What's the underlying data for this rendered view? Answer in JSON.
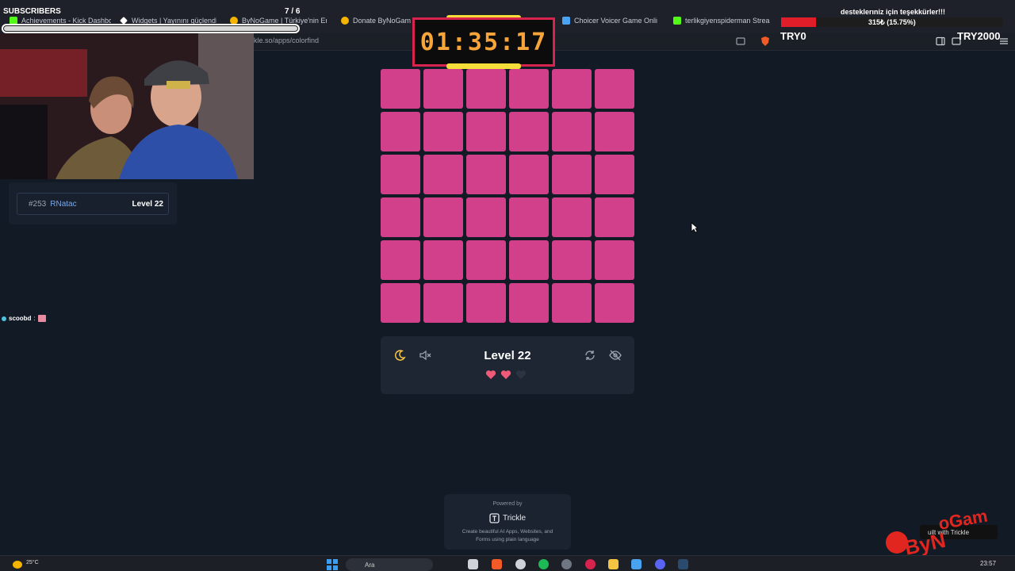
{
  "browser": {
    "tabs": [
      {
        "label": "Achievements - Kick Dashboa",
        "icon": "kick-icon",
        "color": "#53fc18"
      },
      {
        "label": "Widgets | Yayınını güçlendirm",
        "icon": "diamond-icon",
        "color": "#ffffff"
      },
      {
        "label": "ByNoGame | Türkiye'nin En B",
        "icon": "bynogame-icon",
        "color": "#f5b400"
      },
      {
        "label": "Donate ByNoGame |",
        "icon": "bynogame-icon",
        "color": "#f5b400"
      },
      {
        "label": "Choicer Voicer Game Online F",
        "icon": "app-icon",
        "color": "#4aa3f0"
      },
      {
        "label": "terlikgiyenspiderman Stream",
        "icon": "kick-icon",
        "color": "#53fc18"
      }
    ],
    "url": "kle.so/apps/colorfind"
  },
  "overlay": {
    "subscribers_label": "SUBSCRIBERS",
    "subscribers_count": "7 / 6",
    "subscribers_progress": 1.0,
    "donation_title": "desteklerıniz için teşekkürler!!!",
    "donation_text": "315₺ (15.75%)",
    "donation_progress": 0.1575,
    "goal_start": "TRY0",
    "goal_end": "TRY2000"
  },
  "timer": {
    "value": "01:35:17"
  },
  "leaderboard": {
    "rank": "#253",
    "name": "RNatac",
    "level": "Level 22"
  },
  "chat": {
    "user": "scoobd",
    "separator": ":"
  },
  "game": {
    "grid_rows": 6,
    "grid_cols": 6,
    "tile_color": "#d23f8b",
    "level_label": "Level 22",
    "lives_total": 3,
    "lives_remaining": 2,
    "heart_color": "#ef5a78"
  },
  "powered": {
    "label": "Powered by",
    "brand": "Trickle",
    "description": "Create beautiful AI Apps, Websites, and Forms using plain language"
  },
  "builtwith": {
    "label": "uilt with Trickle"
  },
  "taskbar": {
    "weather_temp": "25°C",
    "search_placeholder": "Ara",
    "clock": "23:57"
  }
}
